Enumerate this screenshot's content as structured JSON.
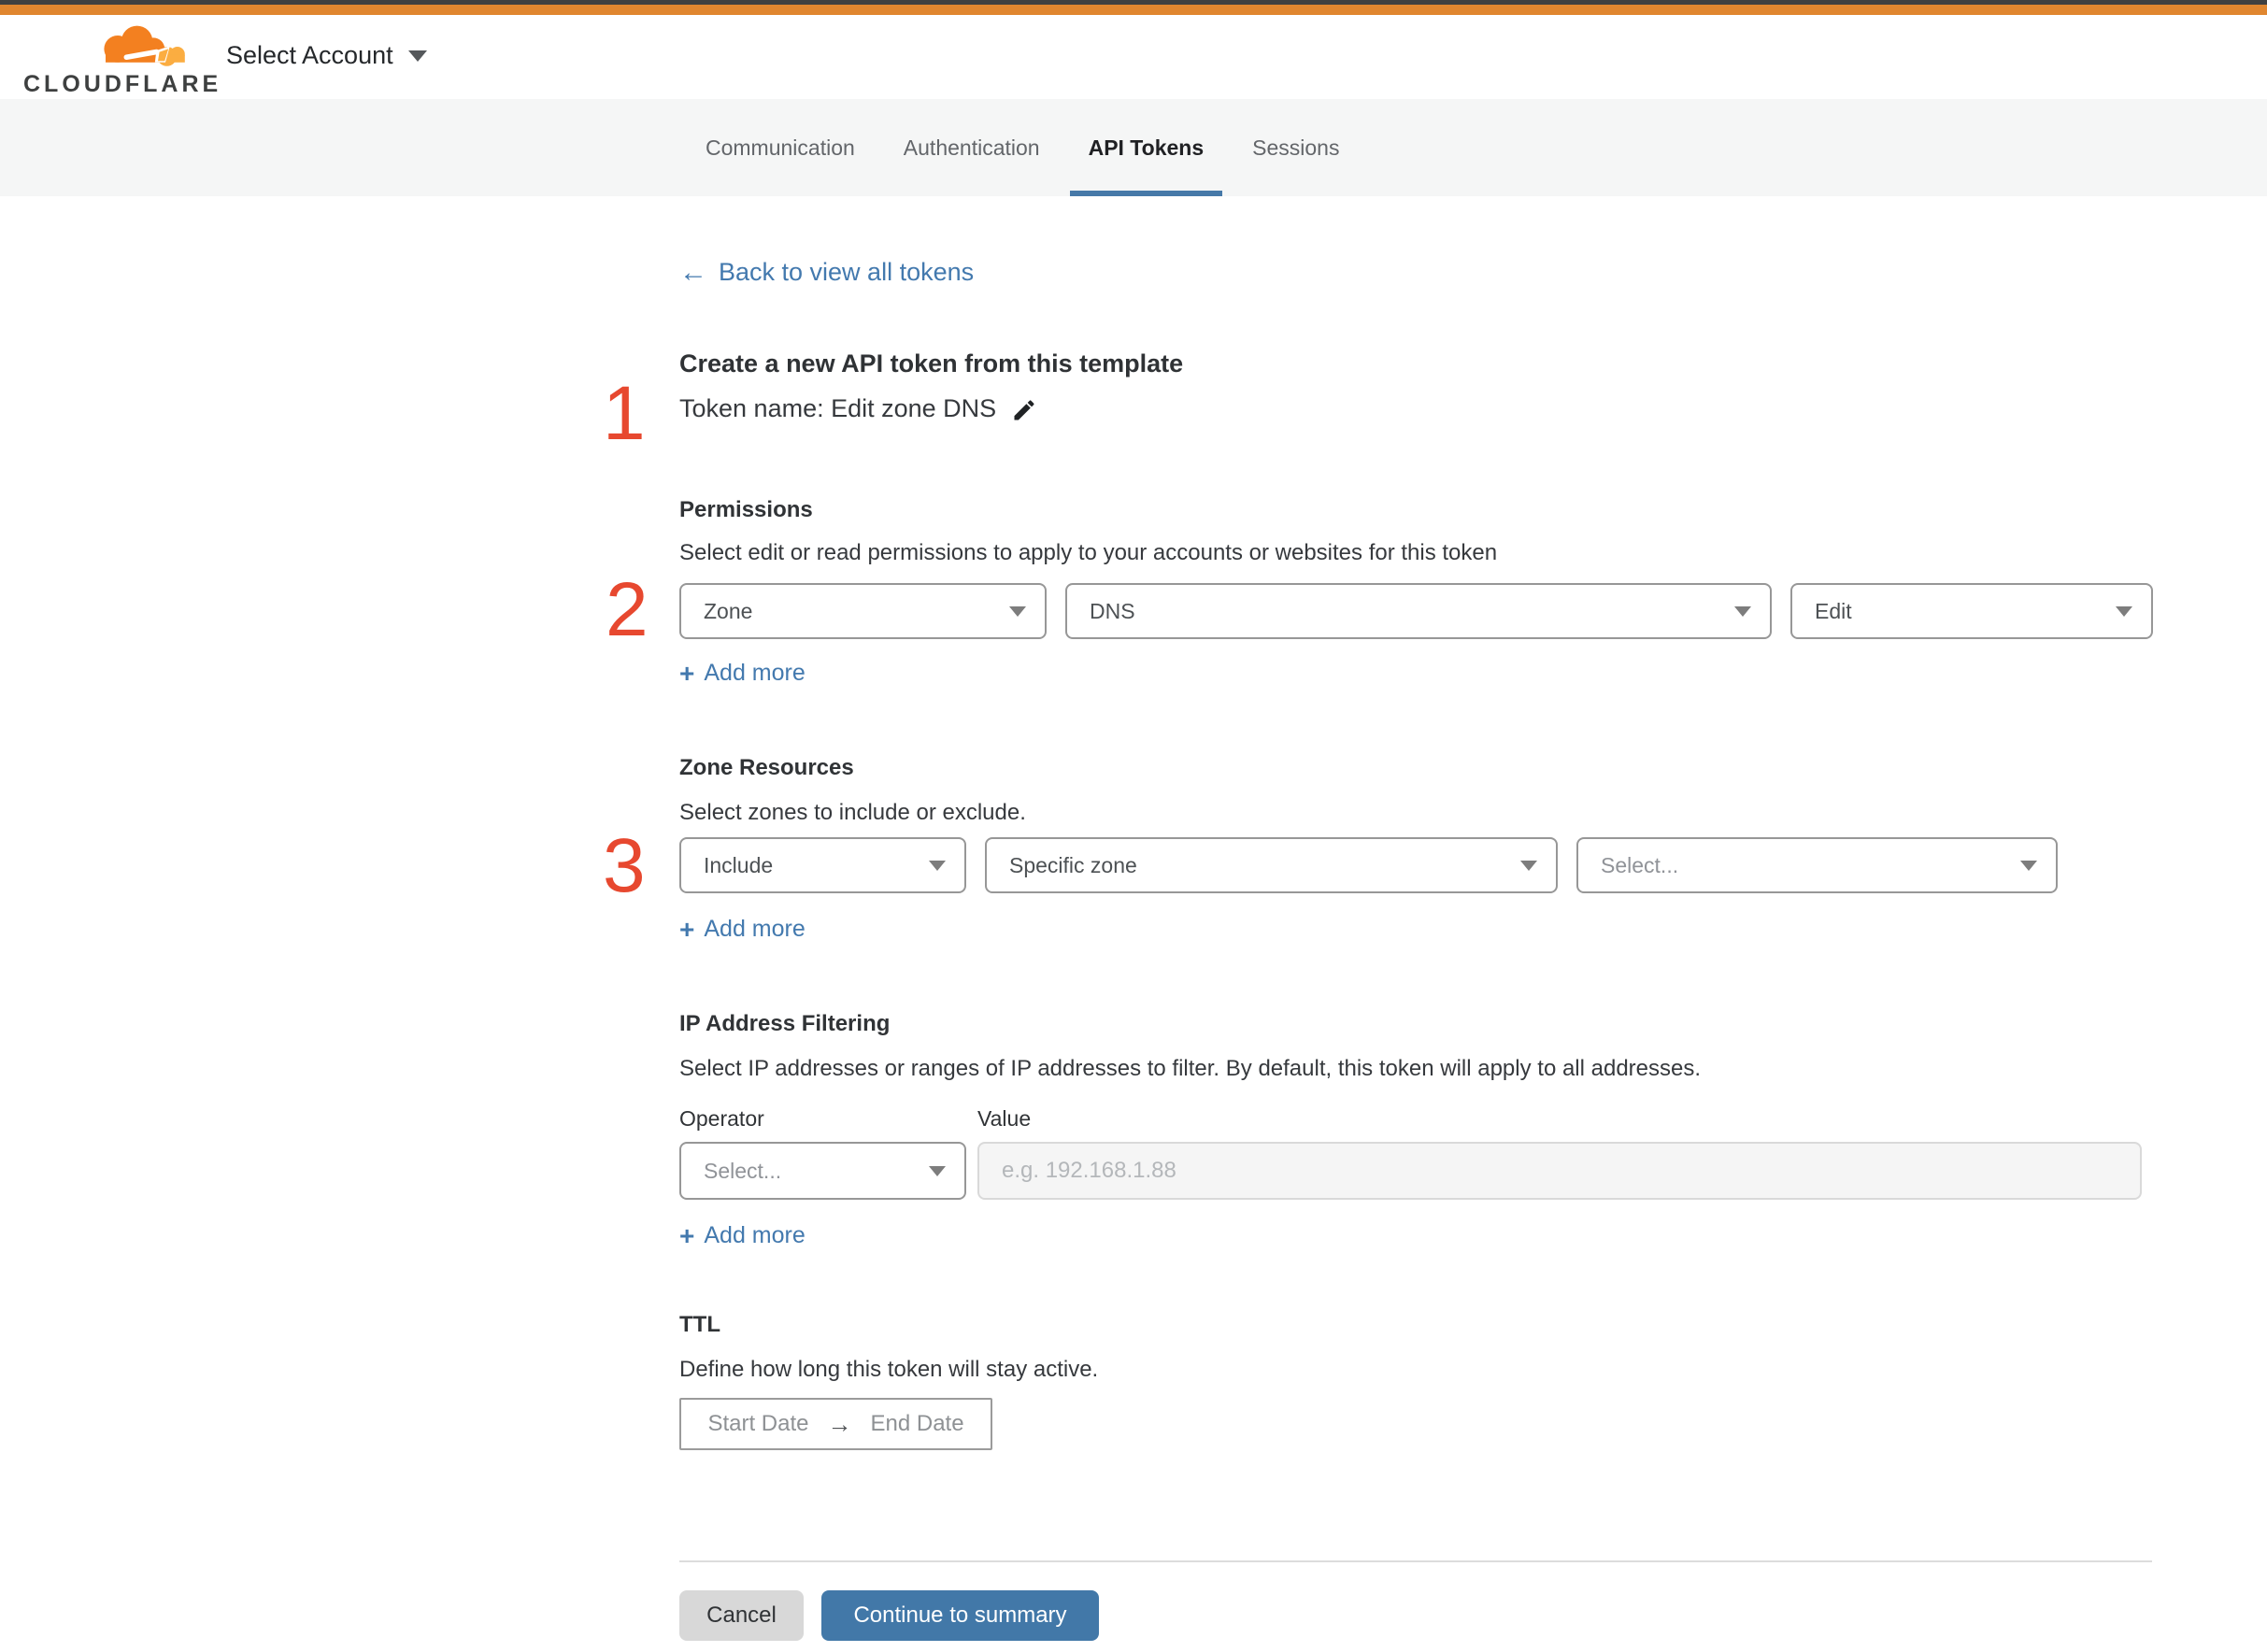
{
  "header": {
    "logo_text": "CLOUDFLARE",
    "account_selector_label": "Select Account"
  },
  "tabs": [
    {
      "label": "Communication",
      "active": false
    },
    {
      "label": "Authentication",
      "active": false
    },
    {
      "label": "API Tokens",
      "active": true
    },
    {
      "label": "Sessions",
      "active": false
    }
  ],
  "active_tab": "API Tokens",
  "back_link": {
    "label": "Back to view all tokens"
  },
  "annotations": {
    "one": "1",
    "two": "2",
    "three": "3"
  },
  "token": {
    "heading": "Create a new API token from this template",
    "name_line": "Token name: Edit zone DNS"
  },
  "permissions": {
    "title": "Permissions",
    "description": "Select edit or read permissions to apply to your accounts or websites for this token",
    "selects": [
      {
        "value": "Zone"
      },
      {
        "value": "DNS"
      },
      {
        "value": "Edit"
      }
    ],
    "add_more_label": "Add more"
  },
  "zone_resources": {
    "title": "Zone Resources",
    "description": "Select zones to include or exclude.",
    "selects": [
      {
        "value": "Include"
      },
      {
        "value": "Specific zone"
      },
      {
        "value": "Select...",
        "is_placeholder": true
      }
    ],
    "add_more_label": "Add more"
  },
  "ip_filtering": {
    "title": "IP Address Filtering",
    "description": "Select IP addresses or ranges of IP addresses to filter. By default, this token will apply to all addresses.",
    "operator_label": "Operator",
    "value_label": "Value",
    "operator_select": {
      "value": "Select...",
      "is_placeholder": true
    },
    "value_input": {
      "value": "",
      "placeholder": "e.g. 192.168.1.88",
      "disabled": true
    },
    "add_more_label": "Add more"
  },
  "ttl": {
    "title": "TTL",
    "description": "Define how long this token will stay active.",
    "start_label": "Start Date",
    "end_label": "End Date"
  },
  "footer": {
    "cancel_label": "Cancel",
    "continue_label": "Continue to summary"
  },
  "icons": {
    "back_arrow": "←",
    "range_arrow": "→",
    "plus": "+"
  },
  "colors": {
    "top_strip_dark": "#3f4040",
    "top_strip_orange": "#e0862f",
    "brand_orange": "#f38020",
    "brand_orange_light": "#fbad41",
    "link_blue": "#4379ae",
    "tab_underline_blue": "#4679a8",
    "continue_button_blue": "#4278a8",
    "cancel_button_gray": "#d8d8d8",
    "annotation_red": "#e7482f",
    "tabbar_background": "#f5f6f6",
    "disabled_input_background": "#f5f5f5"
  }
}
